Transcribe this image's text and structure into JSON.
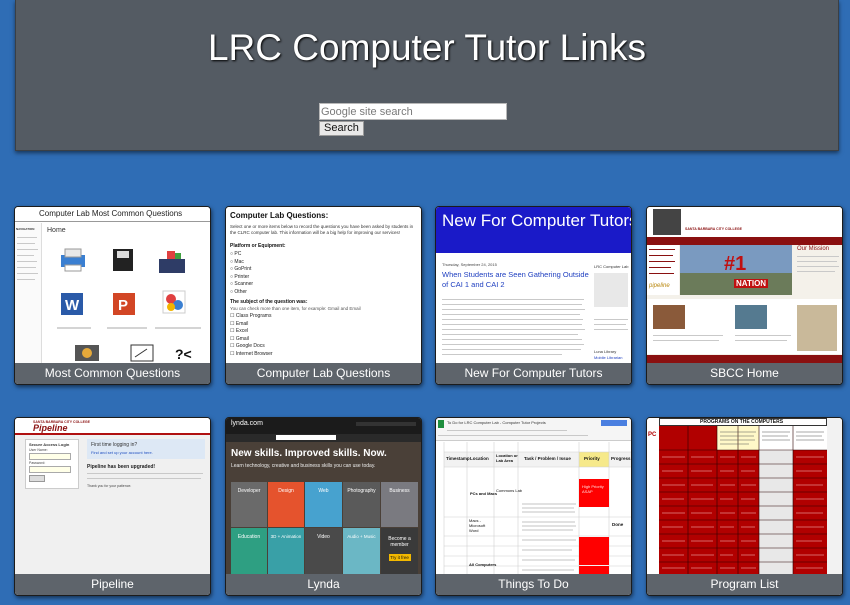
{
  "header": {
    "title": "LRC Computer Tutor Links",
    "search_placeholder": "Google site search",
    "search_button": "Search"
  },
  "tiles": [
    {
      "label": "Most Common Questions",
      "thumb": {
        "title": "Computer Lab Most Common Questions",
        "nav_heading": "NAVIGATION",
        "home": "Home"
      }
    },
    {
      "label": "Computer Lab Questions",
      "thumb": {
        "title": "Computer Lab Questions:",
        "intro": "Select one or more items below to record the questions you have been asked by students in the CLRC computer lab. This information will be a big help for improving our services!",
        "platform_heading": "Platform or Equipment:",
        "options": [
          "PC",
          "Mac",
          "GoPrint",
          "Printer",
          "Scanner",
          "Other"
        ],
        "subject_heading": "The subject of the question was:",
        "subject_hint": "You can check more than one item, for example: Gmail and Email",
        "subjects": [
          "Class Programs",
          "Email",
          "Excel",
          "Gmail",
          "Google Docs",
          "Internet Browser"
        ]
      }
    },
    {
      "label": "New For Computer Tutors",
      "thumb": {
        "blog_title": "New For Computer Tutors",
        "date": "Thursday, September 24, 2015",
        "post_title": "When Students are Seen Gathering Outside of CAI 1 and CAI 2",
        "sidebar_title": "LRC Computer Lab",
        "sidebar_links": [
          "Luna Library",
          "Mobile Librarian",
          "Google Drive"
        ]
      }
    },
    {
      "label": "SBCC Home",
      "thumb": {
        "college": "SANTA BARBARA CITY COLLEGE",
        "banner_number": "#1",
        "banner_word": "NATION",
        "mission": "Our Mission",
        "pipeline": "pipeline"
      }
    },
    {
      "label": "Pipeline",
      "thumb": {
        "college": "SANTA BARBARA CITY COLLEGE",
        "brand": "Pipeline",
        "login_heading": "Secure Access Login",
        "user_label": "User Name:",
        "pass_label": "Password:",
        "first_time": "First time logging in?",
        "setup_link": "Find and set up your account here.",
        "upgraded": "Pipeline has been upgraded!",
        "thanks": "Thank you for your patience."
      }
    },
    {
      "label": "Lynda",
      "thumb": {
        "logo": "lynda.com",
        "headline": "New skills. Improved skills. Now.",
        "subline": "Learn technology, creative and business skills you can use today.",
        "categories": [
          "Developer",
          "Design",
          "Web",
          "Photography",
          "Business",
          "Education",
          "3D + Animation",
          "Video",
          "Audio + Music",
          "Become a member"
        ],
        "cta": "Try it free"
      }
    },
    {
      "label": "Things To Do",
      "thumb": {
        "doc_title": "To Do for LRC Computer Lab - Computer Tutor Projects",
        "headers": [
          "Timestamp",
          "Location",
          "Location or Lab Area",
          "Task / Problem / Issue",
          "Priority",
          "Progress"
        ],
        "row_a_loc": "PCs and Macs",
        "row_a_area": "Commons Lab",
        "row_b_loc": "Macs - Microsoft Word",
        "row_c_loc": "All Computers",
        "priority": "High Priority ASAP",
        "status": "Done"
      }
    },
    {
      "label": "Program List",
      "thumb": {
        "heading": "PROGRAMS ON THE COMPUTERS",
        "side": "PC"
      }
    }
  ],
  "colors": {
    "background": "#2f6db5",
    "header_bg": "#545b63",
    "label_bg": "#5e646b",
    "blog_blue": "#1a1ac8",
    "sbcc_red": "#8a1010",
    "program_red": "#b10000"
  }
}
